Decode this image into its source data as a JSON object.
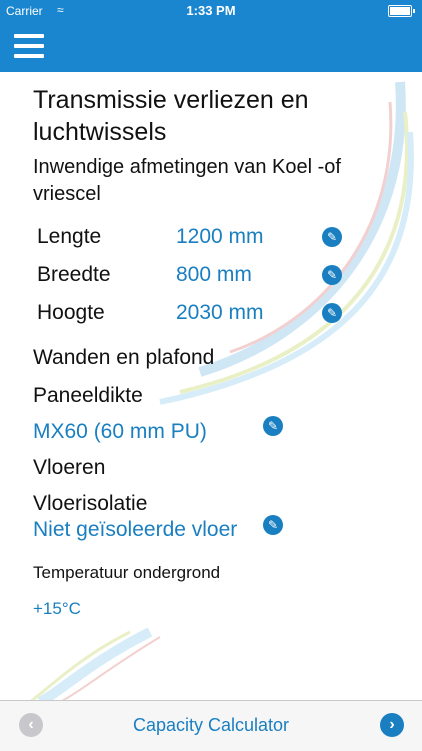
{
  "status_bar": {
    "carrier": "Carrier",
    "time": "1:33 PM"
  },
  "colors": {
    "accent": "#1a86cf",
    "link": "#1a7fc1",
    "toolbar_bg": "#f6f6f7"
  },
  "page": {
    "title": "Transmissie verliezen en luchtwissels",
    "subtitle": "Inwendige afmetingen van Koel -of vriescel"
  },
  "dimensions": [
    {
      "label": "Lengte",
      "value": "1200 mm"
    },
    {
      "label": "Breedte",
      "value": "800 mm"
    },
    {
      "label": "Hoogte",
      "value": "2030 mm"
    }
  ],
  "walls": {
    "heading": "Wanden en plafond",
    "panel_label": "Paneeldikte",
    "panel_value": "MX60 (60 mm PU)"
  },
  "floors": {
    "heading": "Vloeren",
    "insulation_label": "Vloerisolatie",
    "insulation_value": "Niet geïsoleerde vloer",
    "ground_temp_label": "Temperatuur ondergrond",
    "ground_temp_value": "+15°C"
  },
  "toolbar": {
    "title": "Capacity Calculator"
  },
  "icons": {
    "menu": "hamburger-menu-icon",
    "edit": "pencil-icon",
    "prev": "chevron-left-icon",
    "next": "chevron-right-icon"
  }
}
